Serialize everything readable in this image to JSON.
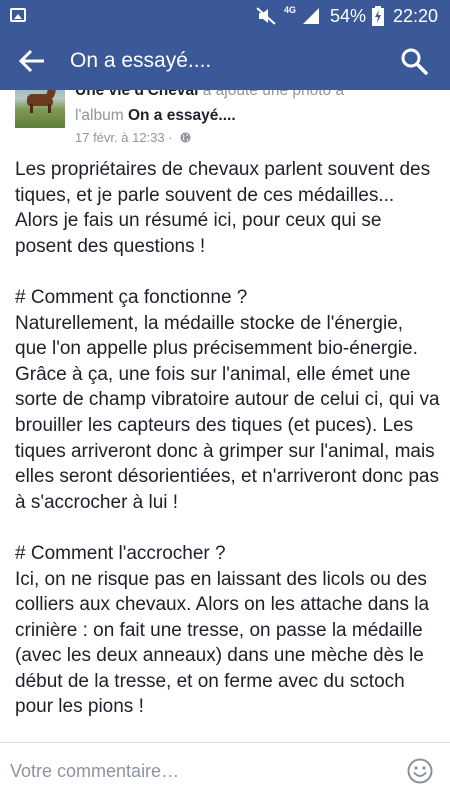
{
  "status_bar": {
    "network": "4G",
    "battery": "54%",
    "time": "22:20",
    "color": "#3b5998"
  },
  "app_bar": {
    "title": "On a essayé....",
    "back_icon": "arrow-left-icon",
    "search_icon": "search-icon"
  },
  "post": {
    "author": "Une vie d'Cheval",
    "action": " a ajouté une photo à",
    "album_prefix": "l'album ",
    "album": "On a essayé....",
    "date": "17 févr. à 12:33 ·",
    "privacy_icon": "globe-icon",
    "paragraphs": [
      "Les propriétaires de chevaux parlent souvent des tiques, et je parle souvent de ces médailles... Alors je fais un résumé ici, pour ceux qui se posent des questions !",
      "# Comment ça fonctionne ?\nNaturellement, la médaille stocke de l'énergie, que l'on appelle plus précisemment bio-énergie. Grâce à ça, une fois sur l'animal, elle émet une sorte de champ vibratoire autour de celui ci, qui va brouiller les capteurs des tiques (et puces). Les tiques arriveront donc à grimper sur l'animal, mais elles seront désorientiées, et n'arriveront donc pas à s'accrocher à lui !",
      "# Comment l'accrocher ?\nIci, on ne risque pas en laissant des licols ou des colliers aux chevaux. Alors on les attache dans la crinière : on fait une tresse, on passe la médaille (avec les deux anneaux) dans une mèche dès le début de la tresse, et on ferme avec du sctoch pour les pions !"
    ]
  },
  "comment_bar": {
    "placeholder": "Votre commentaire…",
    "emoji_icon": "smiley-icon"
  }
}
